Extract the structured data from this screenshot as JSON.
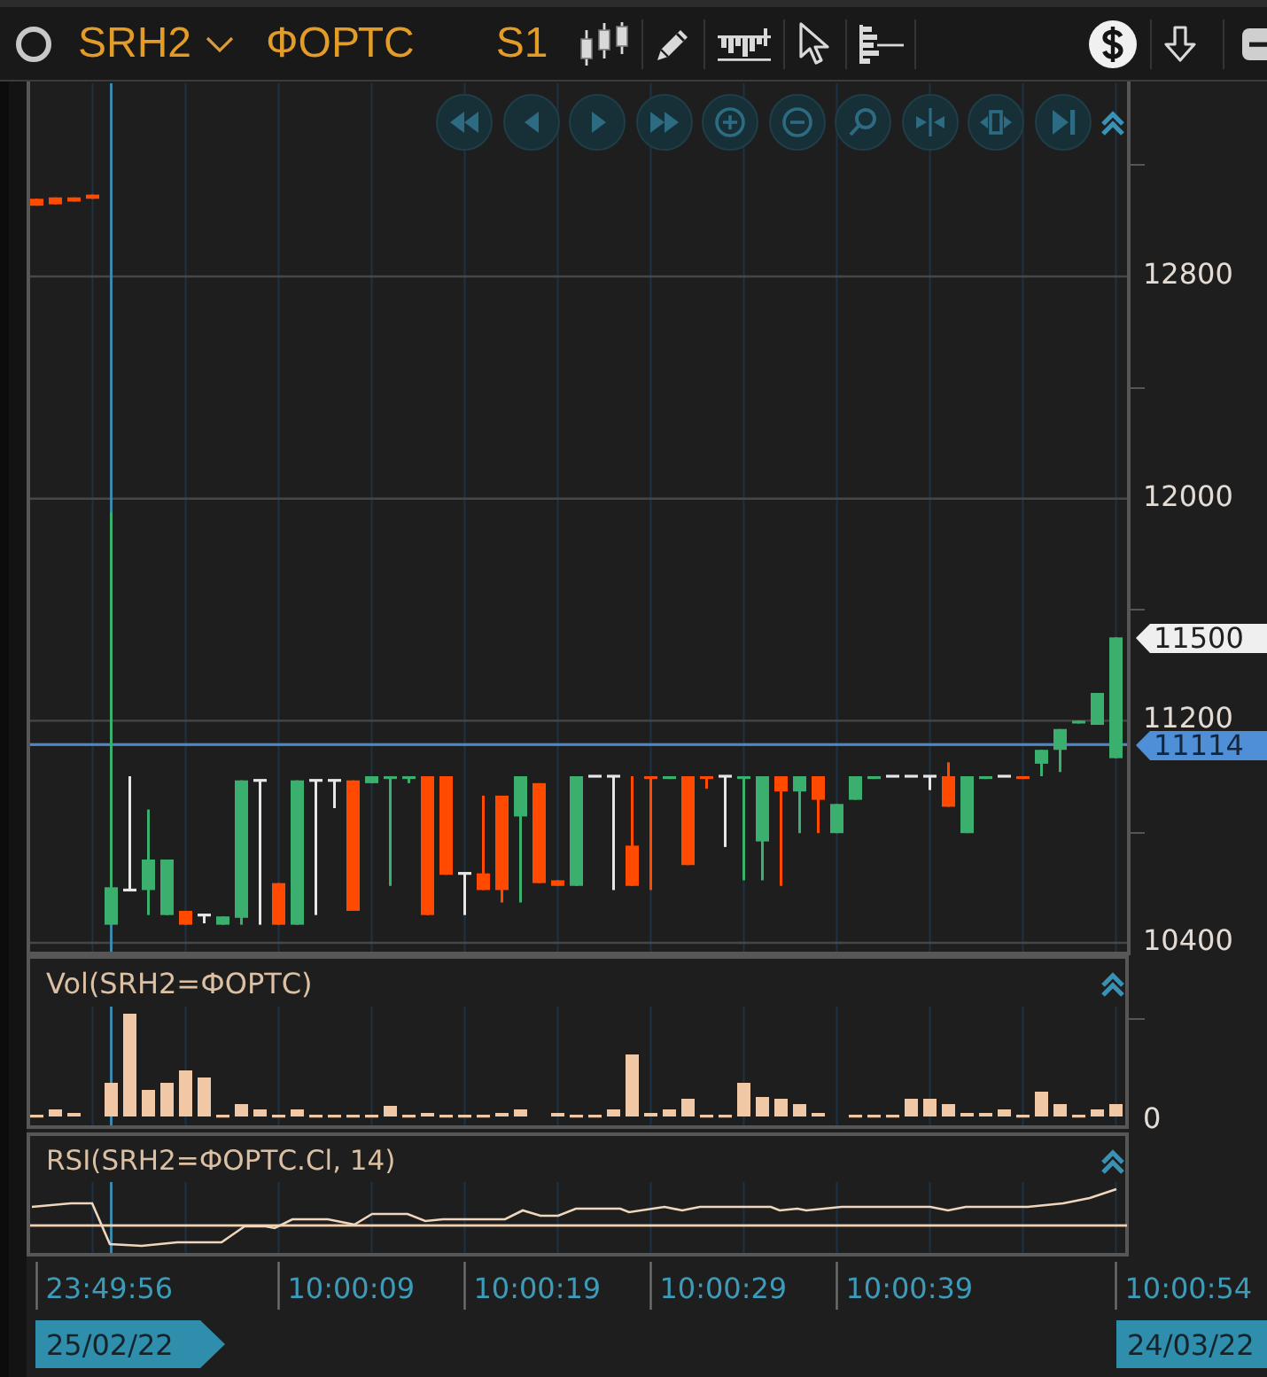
{
  "toolbar": {
    "symbol": "SRH2",
    "exchange": "ФОРТС",
    "timeframe": "S1"
  },
  "price_chart": {
    "chart_data": {
      "type": "candlestick",
      "ohlc": [
        [
          13080,
          13080,
          13055,
          13055
        ],
        [
          13085,
          13085,
          13060,
          13060
        ],
        [
          13085,
          13085,
          13070,
          13070
        ],
        [
          13095,
          13095,
          13080,
          13080
        ],
        [
          10465,
          11950,
          10465,
          10600
        ],
        [
          10590,
          11000,
          10590,
          10590
        ],
        [
          10590,
          10880,
          10500,
          10700
        ],
        [
          10500,
          10700,
          10500,
          10700
        ],
        [
          10515,
          10515,
          10465,
          10465
        ],
        [
          10500,
          10500,
          10470,
          10500
        ],
        [
          10465,
          10495,
          10465,
          10495
        ],
        [
          10490,
          10985,
          10465,
          10985
        ],
        [
          10985,
          10985,
          10465,
          10985
        ],
        [
          10615,
          10615,
          10465,
          10465
        ],
        [
          10465,
          10985,
          10465,
          10985
        ],
        [
          10985,
          10985,
          10500,
          10985
        ],
        [
          10985,
          10985,
          10885,
          10985
        ],
        [
          10985,
          10985,
          10515,
          10515
        ],
        [
          10975,
          11000,
          10975,
          11000
        ],
        [
          10990,
          11000,
          10605,
          11000
        ],
        [
          10990,
          11000,
          10975,
          11000
        ],
        [
          11000,
          11000,
          10500,
          10500
        ],
        [
          11000,
          11000,
          10645,
          10645
        ],
        [
          10650,
          10650,
          10500,
          10650
        ],
        [
          10650,
          10930,
          10590,
          10590
        ],
        [
          10930,
          10930,
          10545,
          10590
        ],
        [
          10855,
          11000,
          10545,
          11000
        ],
        [
          10975,
          10975,
          10615,
          10615
        ],
        [
          10625,
          10625,
          10605,
          10605
        ],
        [
          10605,
          11000,
          10605,
          11000
        ],
        [
          11000,
          11000,
          11000,
          11000
        ],
        [
          11000,
          11000,
          10590,
          11000
        ],
        [
          10750,
          11000,
          10605,
          10605
        ],
        [
          11000,
          11000,
          10590,
          10990
        ],
        [
          10990,
          11000,
          10990,
          11000
        ],
        [
          11000,
          11000,
          10680,
          10680
        ],
        [
          11000,
          11000,
          10955,
          10990
        ],
        [
          11000,
          11000,
          10745,
          11000
        ],
        [
          10990,
          11000,
          10625,
          11000
        ],
        [
          10765,
          11000,
          10625,
          11000
        ],
        [
          11000,
          11000,
          10605,
          10945
        ],
        [
          10945,
          11000,
          10795,
          11000
        ],
        [
          11000,
          11000,
          10795,
          10915
        ],
        [
          10795,
          10900,
          10795,
          10900
        ],
        [
          10915,
          11000,
          10915,
          11000
        ],
        [
          10990,
          11000,
          10990,
          11000
        ],
        [
          11000,
          11000,
          11000,
          11000
        ],
        [
          11000,
          11000,
          11000,
          11000
        ],
        [
          11000,
          11000,
          10950,
          11000
        ],
        [
          11000,
          11050,
          10890,
          10890
        ],
        [
          10795,
          11000,
          10795,
          11000
        ],
        [
          10990,
          11000,
          10990,
          11000
        ],
        [
          11000,
          11000,
          11000,
          11000
        ],
        [
          11000,
          11000,
          10990,
          10990
        ],
        [
          11045,
          11095,
          11000,
          11095
        ],
        [
          11095,
          11170,
          11015,
          11170
        ],
        [
          11190,
          11200,
          11190,
          11200
        ],
        [
          11185,
          11300,
          11185,
          11300
        ],
        [
          11065,
          11500,
          11065,
          11500
        ]
      ],
      "ylim": [
        10368,
        13496
      ],
      "yticks": [
        {
          "value": 12800,
          "label": "12800"
        },
        {
          "value": 12000,
          "label": "12000"
        },
        {
          "value": 11200,
          "label": "11200"
        },
        {
          "value": 10400,
          "label": "10400"
        }
      ],
      "grid": true,
      "ref_lines": [
        {
          "axis": "y",
          "value": 11114,
          "color": "#4f86c6"
        }
      ]
    },
    "markers": [
      {
        "label": "11500",
        "kind": "last"
      },
      {
        "label": "11114",
        "kind": "cursor"
      }
    ]
  },
  "volume_panel": {
    "title": "Vol(SRH2=ФОРТС)",
    "axis_labels": [
      "0"
    ]
  },
  "rsi_panel": {
    "title": "RSI(SRH2=ФОРТС.Cl, 14)"
  },
  "time_axis": {
    "labels": [
      "23:49:56",
      "10:00:09",
      "10:00:19",
      "10:00:29",
      "10:00:39",
      "10:00:54"
    ],
    "date_flags": [
      "25/02/22",
      "24/03/22"
    ]
  }
}
